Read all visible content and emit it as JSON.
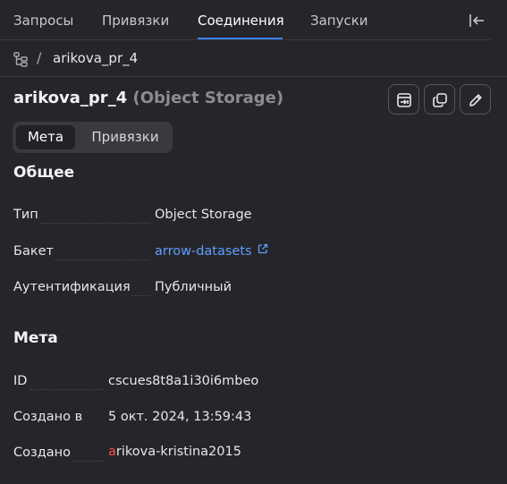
{
  "tabs": [
    {
      "label": "Запросы"
    },
    {
      "label": "Привязки"
    },
    {
      "label": "Соединения",
      "active": true
    },
    {
      "label": "Запуски"
    }
  ],
  "breadcrumb": {
    "icon": "tree-icon",
    "separator": "/",
    "item": "arikova_pr_4"
  },
  "header": {
    "title": "arikova_pr_4",
    "subtitle": "(Object Storage)",
    "actions": [
      "import-icon",
      "copy-icon",
      "edit-icon"
    ]
  },
  "segment": {
    "items": [
      {
        "label": "Мета",
        "active": true
      },
      {
        "label": "Привязки"
      }
    ]
  },
  "general": {
    "title": "Общее",
    "rows": [
      {
        "label": "Тип",
        "value": "Object Storage"
      },
      {
        "label": "Бакет",
        "value": "arrow-datasets",
        "link": true
      },
      {
        "label": "Аутентификация",
        "value": "Публичный"
      }
    ]
  },
  "meta": {
    "title": "Мета",
    "rows": [
      {
        "label": "ID",
        "value": "cscues8t8a1i30i6mbeo"
      },
      {
        "label": "Создано в",
        "value": "5 окт. 2024, 13:59:43"
      },
      {
        "label": "Создано",
        "value_first": "a",
        "value_rest": "rikova-kristina2015"
      }
    ]
  },
  "colors": {
    "background": "#262529",
    "accent": "#3f83f8",
    "link": "#5da0ff",
    "avatar_letter": "#ff4d4d"
  }
}
